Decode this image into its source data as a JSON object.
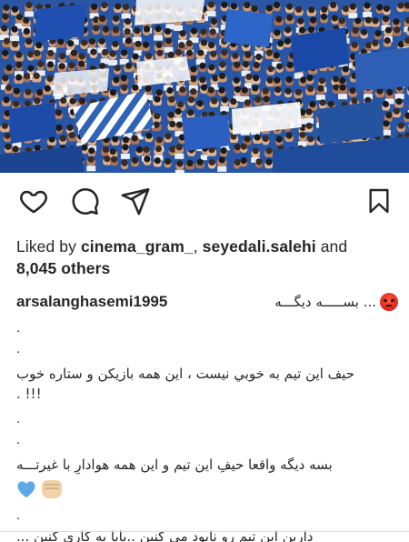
{
  "photo": {
    "description_icon": "crowd-photo"
  },
  "actions": {
    "like_icon": "heart-icon",
    "comment_icon": "comment-icon",
    "share_icon": "paper-plane-icon",
    "save_icon": "bookmark-icon"
  },
  "likes": {
    "prefix": "Liked by ",
    "user1": "cinema_gram_",
    "sep": ", ",
    "user2": "seyedali.salehi",
    "and": " and",
    "others": "8,045 others"
  },
  "caption": {
    "username": "arsalanghasemi1995",
    "first_line": "... بســـــه دیگـــه",
    "dot1": ".",
    "dot2": ".",
    "line1": "حیف این تیم به خوبي نیست ، این همه بازیکن و ستاره خوب",
    "line1b": ". !!!",
    "dot3": ".",
    "dot4": ".",
    "line2": "بسه دیگه واقعا حیفِ این تیم و این همه هوادارِ با غیرتـــه",
    "dot5": ".",
    "line3": "دارین این تیم رو نابود مي کنین ..بابا یه کاري کنین ..."
  },
  "colors": {
    "text": "#262626",
    "divider": "#dbdbdb",
    "heart_blue": "#5fa8e8",
    "crowd_blue": "#1f4fa0"
  }
}
